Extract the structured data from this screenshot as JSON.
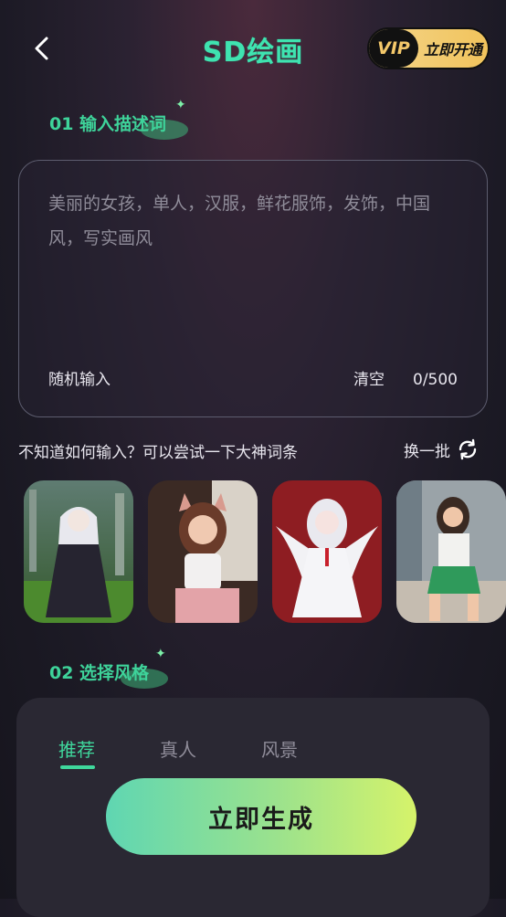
{
  "header": {
    "title": "SD绘画",
    "back_icon": "chevron-left-icon",
    "vip": {
      "tag": "VIP",
      "label": "立即开通"
    }
  },
  "section1": {
    "title": "01 输入描述词"
  },
  "prompt": {
    "text": "美丽的女孩，单人，汉服，鲜花服饰，发饰，中国风，写实画风",
    "random_label": "随机输入",
    "clear_label": "清空",
    "counter": "0/500"
  },
  "hint": {
    "text": "不知道如何输入？可以尝试一下大神词条",
    "refresh_label": "换一批",
    "refresh_icon": "refresh-icon"
  },
  "thumbnails": [
    {
      "name": "thumb-anime-forest-girl"
    },
    {
      "name": "thumb-cat-ears-girl"
    },
    {
      "name": "thumb-angel-girl"
    },
    {
      "name": "thumb-sailor-girl"
    }
  ],
  "section2": {
    "title": "02 选择风格"
  },
  "style_tabs": [
    {
      "label": "推荐",
      "active": true
    },
    {
      "label": "真人",
      "active": false
    },
    {
      "label": "风景",
      "active": false
    }
  ],
  "generate": {
    "label": "立即生成"
  },
  "colors": {
    "accent": "#3fd79c",
    "vip_gold": "#f1c45c"
  }
}
